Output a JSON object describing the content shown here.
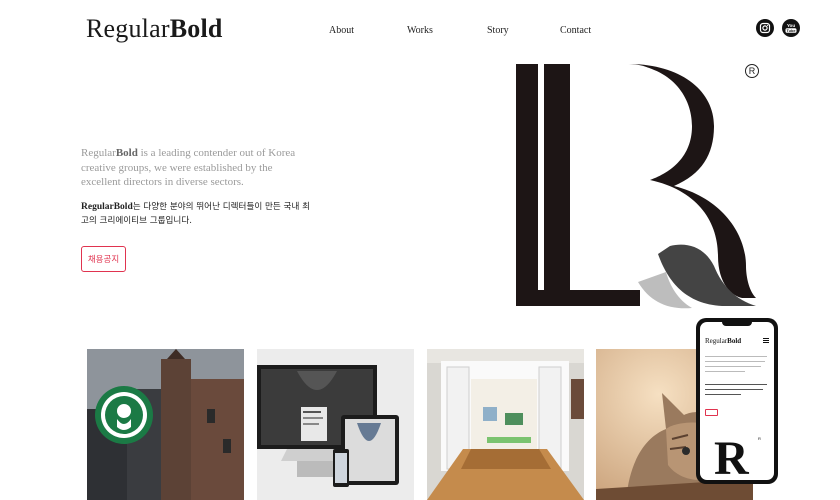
{
  "brand": {
    "regular": "Regular",
    "bold": "Bold"
  },
  "nav": {
    "items": [
      {
        "label": "About"
      },
      {
        "label": "Works"
      },
      {
        "label": "Story"
      },
      {
        "label": "Contact"
      }
    ]
  },
  "social": {
    "instagram_icon": "instagram-icon",
    "youtube_label": "You Tube"
  },
  "hero": {
    "mark_letter": "B",
    "registered": "R",
    "intro_en_rest": " is a leading contender out of Korea creative groups, we were established by the excellent directors in diverse sectors.",
    "intro_ko_rest": "는 다양한 분야의 뛰어난 디렉터들이 만든 국내 최고의 크리에이티브 그룹입니다.",
    "cta_label": "채용공지"
  },
  "works": [
    {
      "name": "Starbucks storefront"
    },
    {
      "name": "Laptop and devices mockup"
    },
    {
      "name": "Living room doorway"
    },
    {
      "name": "Kitten"
    }
  ],
  "mobile_preview": {
    "mark_letter": "R",
    "registered": "R"
  },
  "colors": {
    "accent": "#e0334f",
    "ink": "#1a1a1a",
    "muted": "#9a9a9a"
  }
}
